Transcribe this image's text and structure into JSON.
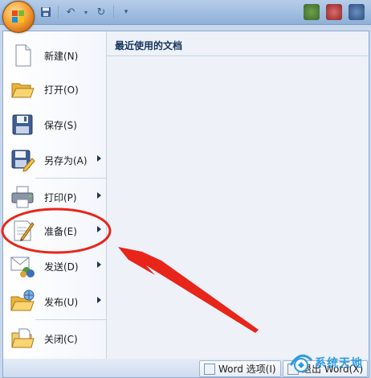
{
  "menu": {
    "items": [
      {
        "label": "新建(N)",
        "icon": "new-document-icon",
        "submenu": false
      },
      {
        "label": "打开(O)",
        "icon": "open-folder-icon",
        "submenu": false
      },
      {
        "label": "保存(S)",
        "icon": "save-disk-icon",
        "submenu": false
      },
      {
        "label": "另存为(A)",
        "icon": "save-as-icon",
        "submenu": true
      },
      {
        "label": "打印(P)",
        "icon": "printer-icon",
        "submenu": true
      },
      {
        "label": "准备(E)",
        "icon": "prepare-document-icon",
        "submenu": true
      },
      {
        "label": "发送(D)",
        "icon": "send-mail-icon",
        "submenu": true
      },
      {
        "label": "发布(U)",
        "icon": "publish-folder-icon",
        "submenu": true
      },
      {
        "label": "关闭(C)",
        "icon": "close-folder-icon",
        "submenu": false
      }
    ]
  },
  "recent": {
    "title": "最近使用的文档"
  },
  "footer": {
    "options_label": "Word 选项(I)",
    "exit_label": "退出 Word(X)"
  },
  "watermark": {
    "text": "系统天地"
  },
  "colors": {
    "annotation_red": "#e8251b",
    "accent_blue": "#15325d"
  }
}
